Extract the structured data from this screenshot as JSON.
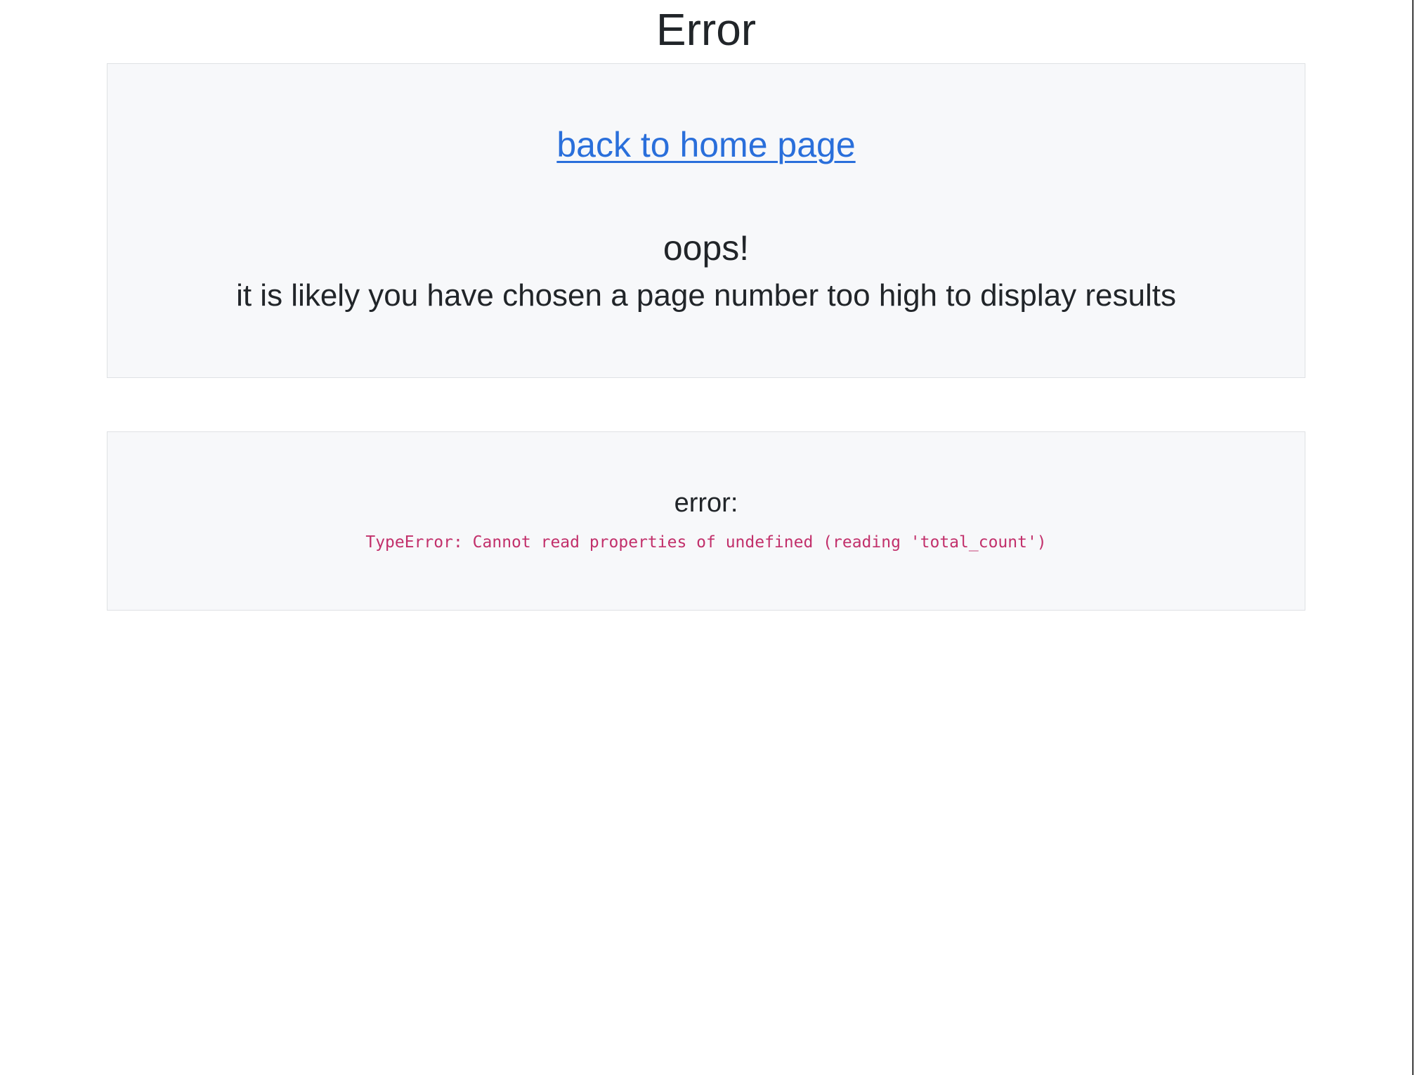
{
  "page": {
    "title": "Error"
  },
  "oops_panel": {
    "home_link_label": "back to home page",
    "heading": "oops!",
    "message": "it is likely you have chosen a page number too high to display results"
  },
  "error_panel": {
    "heading": "error:",
    "detail": "TypeError: Cannot read properties of undefined (reading 'total_count')"
  },
  "colors": {
    "text": "#212529",
    "link": "#2a6fdb",
    "panel_background": "#f7f8fa",
    "panel_border": "#dfe1e4",
    "error_code": "#c2306b"
  }
}
